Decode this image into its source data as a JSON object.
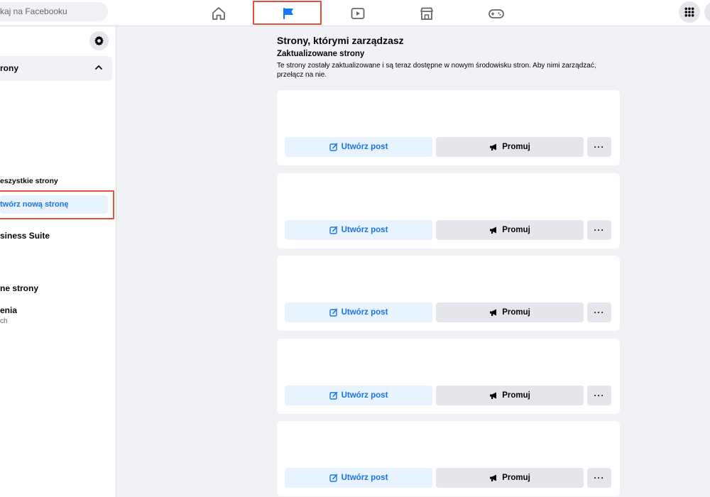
{
  "search": {
    "placeholder": "kaj na Facebooku"
  },
  "nav": {
    "icons": [
      "home-icon",
      "flag-icon",
      "watch-icon",
      "marketplace-icon",
      "gaming-icon"
    ],
    "active": "flag-icon",
    "highlight_color": "#e0533d"
  },
  "sidebar": {
    "section_label": "rony",
    "all_pages": "eszystkie strony",
    "create_page": "twórz nową stronę",
    "business_suite": "siness Suite",
    "liked_pages": "ne strony",
    "invites_label": "enia",
    "invites_sub": "ch"
  },
  "main": {
    "title": "Strony, którymi zarządzasz",
    "subtitle": "Zaktualizowane strony",
    "description": "Te strony zostały zaktualizowane i są teraz dostępne w nowym środowisku stron. Aby nimi zarządzać, przełącz na nie.",
    "cards": [
      {
        "create_label": "Utwórz post",
        "promote_label": "Promuj",
        "more_label": "···"
      },
      {
        "create_label": "Utwórz post",
        "promote_label": "Promuj",
        "more_label": "···"
      },
      {
        "create_label": "Utwórz post",
        "promote_label": "Promuj",
        "more_label": "···"
      },
      {
        "create_label": "Utwórz post",
        "promote_label": "Promuj",
        "more_label": "···"
      },
      {
        "create_label": "Utwórz post",
        "promote_label": "Promuj",
        "more_label": "···"
      }
    ]
  },
  "colors": {
    "accent": "#1b74e4",
    "accent_bg": "#e7f3ff",
    "button_gray": "#e4e6eb",
    "page_bg": "#f0f2f5"
  }
}
